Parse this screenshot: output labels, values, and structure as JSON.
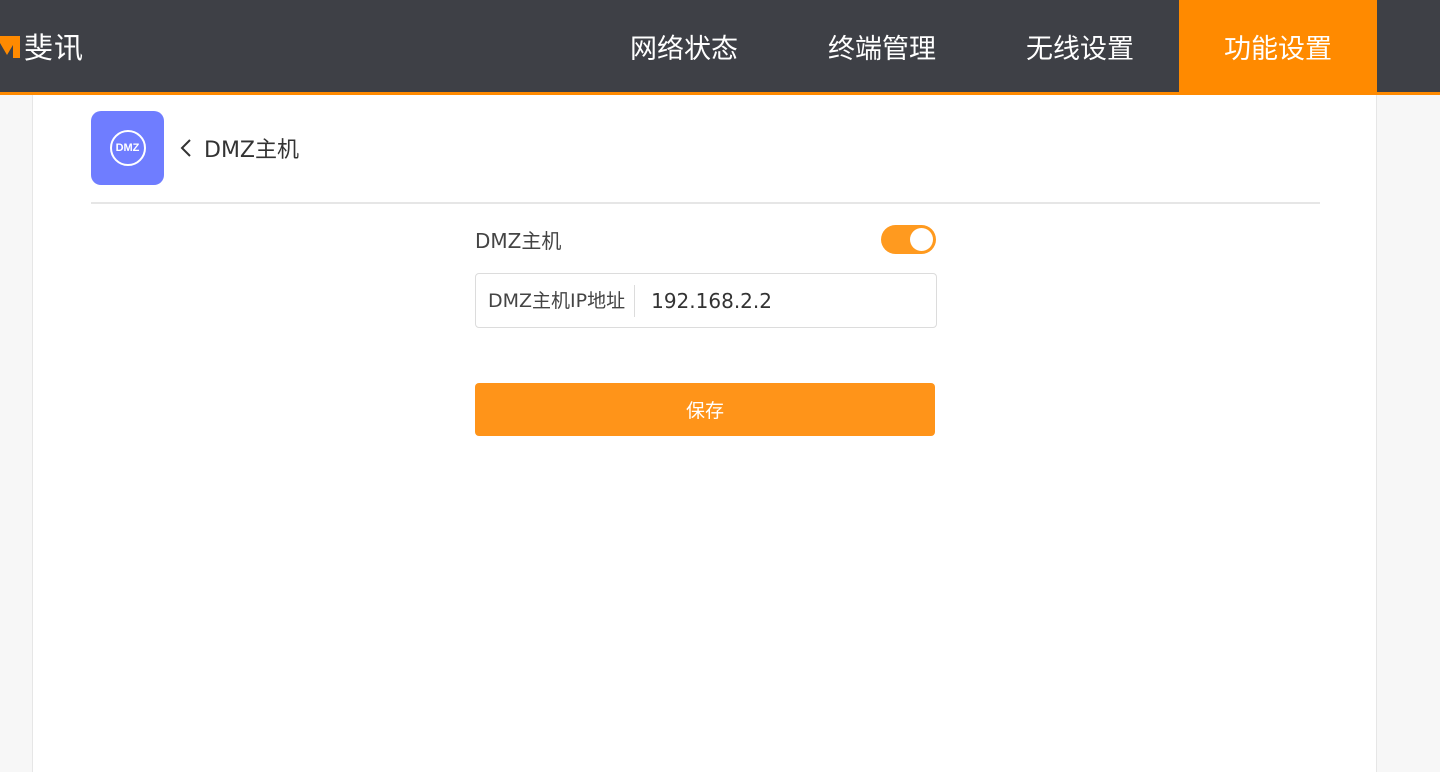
{
  "header": {
    "brand": "斐讯",
    "logo_icon": "brand-logo-icon",
    "nav": [
      {
        "label": "网络状态",
        "active": false
      },
      {
        "label": "终端管理",
        "active": false
      },
      {
        "label": "无线设置",
        "active": false
      },
      {
        "label": "功能设置",
        "active": true
      }
    ]
  },
  "page": {
    "icon_text": "DMZ",
    "back_icon": "chevron-left-icon",
    "title": "DMZ主机"
  },
  "form": {
    "dmz_toggle_label": "DMZ主机",
    "dmz_enabled": true,
    "ip_label": "DMZ主机IP地址",
    "ip_value": "192.168.2.2",
    "save_label": "保存"
  },
  "colors": {
    "header_bg": "#3e4046",
    "accent": "#ff8a00",
    "toggle_on": "#ff9a1f",
    "page_icon_bg": "#6f7dff"
  }
}
